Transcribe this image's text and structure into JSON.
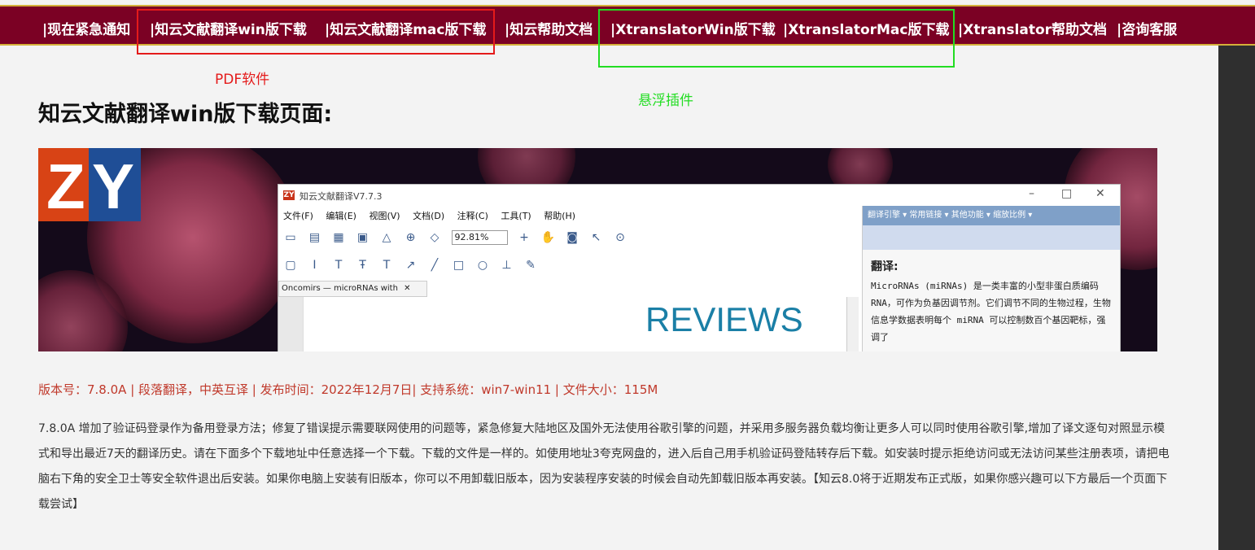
{
  "nav": {
    "items": [
      "|现在紧急通知",
      "|知云文献翻译win版下载",
      "|知云文献翻译mac版下载",
      "|知云帮助文档",
      "|XtranslatorWin版下载",
      "|XtranslatorMac版下载",
      "|Xtranslator帮助文档",
      "|咨询客服"
    ]
  },
  "annotations": {
    "red_label": "PDF软件",
    "green_label": "悬浮插件",
    "red_color": "#e41a1a",
    "green_color": "#22dd22"
  },
  "page_title": "知云文献翻译win版下载页面:",
  "banner": {
    "logo_text": "ZY",
    "window_title": "知云文献翻译V7.7.3",
    "menu": [
      "文件(F)",
      "编辑(E)",
      "视图(V)",
      "文档(D)",
      "注释(C)",
      "工具(T)",
      "帮助(H)"
    ],
    "zoom": "92.81%",
    "doc_tab": "Oncomirs — microRNAs with",
    "doc_heading": "REVIEWS",
    "translate_bar": "翻译引擎 ▾  常用链接 ▾  其他功能 ▾  缩放比例 ▾",
    "translate_head": "翻译:",
    "translate_text": "MicroRNAs (miRNAs) 是一类丰富的小型非蛋白质编码 RNA，可作为负基因调节剂。它们调节不同的生物过程，生物信息学数据表明每个 miRNA 可以控制数百个基因靶标，强调了"
  },
  "version_line": "版本号：7.8.0A | 段落翻译，中英互译 | 发布时间：2022年12月7日| 支持系统：win7-win11 | 文件大小：115M",
  "description": "7.8.0A 增加了验证码登录作为备用登录方法；修复了错误提示需要联网使用的问题等，紧急修复大陆地区及国外无法使用谷歌引擎的问题，并采用多服务器负载均衡让更多人可以同时使用谷歌引擎,增加了译文逐句对照显示模式和导出最近7天的翻译历史。请在下面多个下载地址中任意选择一个下载。下载的文件是一样的。如使用地址3夸克网盘的，进入后自己用手机验证码登陆转存后下载。如安装时提示拒绝访问或无法访问某些注册表项，请把电脑右下角的安全卫士等安全软件退出后安装。如果你电脑上安装有旧版本，你可以不用卸载旧版本，因为安装程序安装的时候会自动先卸载旧版本再安装。【知云8.0将于近期发布正式版，如果你感兴趣可以下方最后一个页面下载尝试】"
}
